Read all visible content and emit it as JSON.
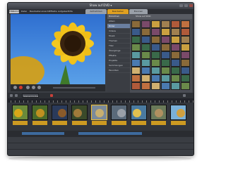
{
  "window": {
    "title": "Show auf DVD ▾"
  },
  "menubar": {
    "logo": "PINNACLE",
    "items": [
      "Datei",
      "Bearbeiten",
      "Ansicht",
      "Effekte",
      "Aufgaben",
      "Hilfe"
    ],
    "tabs": [
      "Aufnehmen",
      "Bearbeiten",
      "Brennen"
    ]
  },
  "library": {
    "header": [
      "Bibliothek",
      "Show auf DVD"
    ],
    "tree": [
      "Alben",
      "Bilder",
      "Videos",
      "Musik",
      "Themen",
      "Titel",
      "Übergänge",
      "Effekte",
      "Projekte",
      "Sammlungen",
      "Favoriten"
    ],
    "selected_tree": 1
  },
  "controls": {
    "dropdown": "Szenenmodus"
  },
  "colors": {
    "accent": "#f0c030",
    "clip_label": "#cc9a22",
    "record": "#d33a2c"
  }
}
